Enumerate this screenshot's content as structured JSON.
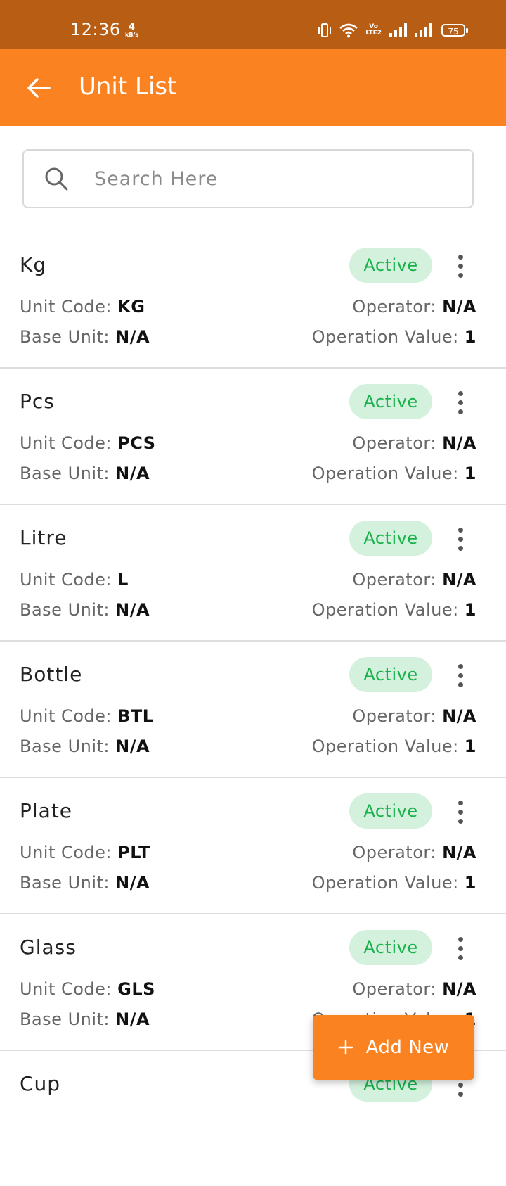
{
  "status_bar": {
    "time": "12:36",
    "net_speed_value": "4",
    "net_speed_unit": "kB/s",
    "volte_line1": "Vo",
    "volte_line2": "LTE2",
    "battery": "75"
  },
  "app_bar": {
    "title": "Unit List",
    "back_icon": "arrow-left-icon"
  },
  "search": {
    "placeholder": "Search Here",
    "value": ""
  },
  "labels": {
    "unit_code": "Unit Code: ",
    "base_unit": "Base Unit: ",
    "operator": "Operator: ",
    "operation_value": "Operation Value: "
  },
  "units": [
    {
      "name": "Kg",
      "status": "Active",
      "unit_code": "KG",
      "base_unit": "N/A",
      "operator": "N/A",
      "operation_value": "1"
    },
    {
      "name": "Pcs",
      "status": "Active",
      "unit_code": "PCS",
      "base_unit": "N/A",
      "operator": "N/A",
      "operation_value": "1"
    },
    {
      "name": "Litre",
      "status": "Active",
      "unit_code": "L",
      "base_unit": "N/A",
      "operator": "N/A",
      "operation_value": "1"
    },
    {
      "name": "Bottle",
      "status": "Active",
      "unit_code": "BTL",
      "base_unit": "N/A",
      "operator": "N/A",
      "operation_value": "1"
    },
    {
      "name": "Plate",
      "status": "Active",
      "unit_code": "PLT",
      "base_unit": "N/A",
      "operator": "N/A",
      "operation_value": "1"
    },
    {
      "name": "Glass",
      "status": "Active",
      "unit_code": "GLS",
      "base_unit": "N/A",
      "operator": "N/A",
      "operation_value": "1"
    },
    {
      "name": "Cup",
      "status": "Active",
      "unit_code": "",
      "base_unit": "",
      "operator": "",
      "operation_value": ""
    }
  ],
  "fab": {
    "label": "Add New",
    "icon": "plus-icon"
  },
  "colors": {
    "status_bar": "#b85d14",
    "primary": "#fb8221",
    "badge_bg": "#d3f1dd",
    "badge_text": "#19b14b"
  }
}
